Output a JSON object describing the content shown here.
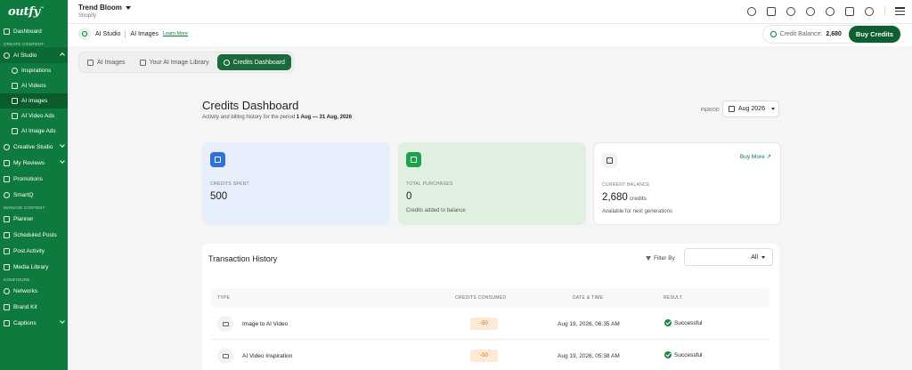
{
  "sidebar": {
    "logo": "outfy",
    "logo_mark": "™",
    "items": [
      {
        "label": "Dashboard"
      },
      {
        "section": "Create Content"
      },
      {
        "label": "AI Studio"
      },
      {
        "label": "Inspirations"
      },
      {
        "label": "AI Videos"
      },
      {
        "label": "AI Images"
      },
      {
        "label": "AI Video Ads"
      },
      {
        "label": "AI Image Ads"
      },
      {
        "label": "Creative Studio"
      },
      {
        "label": "My Reviews"
      },
      {
        "label": "Promotions"
      },
      {
        "label": "SmartQ"
      },
      {
        "section": "Manage Content"
      },
      {
        "label": "Planner"
      },
      {
        "label": "Scheduled Posts"
      },
      {
        "label": "Post Activity"
      },
      {
        "label": "Media Library"
      },
      {
        "section": "Configure"
      },
      {
        "label": "Networks"
      },
      {
        "label": "Brand Kit"
      },
      {
        "label": "Captions"
      }
    ]
  },
  "topbar": {
    "brand": "Trend Bloom",
    "platform": "Shopify"
  },
  "subbar": {
    "crumb_root": "AI Studio",
    "crumb_current": "AI Images",
    "learn_more": "Learn More",
    "credit_label": "Credit Balance:",
    "credit_value": "2,680",
    "buy_credits": "Buy Credits"
  },
  "tabs": [
    {
      "label": "AI Images"
    },
    {
      "label": "Your AI Image Library"
    },
    {
      "label": "Credits Dashboard"
    }
  ],
  "dashboard": {
    "title": "Credits Dashboard",
    "subtitle": "Activity and billing history for the period",
    "period_range": "1 Aug — 31 Aug, 2026",
    "period_label": "PERIOD",
    "period_value": "Aug 2026"
  },
  "cards": {
    "spent": {
      "label": "CREDITS SPENT",
      "value": "500"
    },
    "purchases": {
      "label": "TOTAL PURCHASES",
      "value": "0",
      "note": "Credits added to balance"
    },
    "balance": {
      "label": "CURRENT BALANCE",
      "value": "2,680",
      "unit": "credits",
      "note": "Available for next generations",
      "buy_more": "Buy More"
    }
  },
  "transactions": {
    "title": "Transaction History",
    "filter_label": "Filter By",
    "filter_value": "All",
    "columns": [
      "TYPE",
      "CREDITS CONSUMED",
      "DATE & TIME",
      "RESULT"
    ],
    "rows": [
      {
        "type": "Image to AI Video",
        "credits": "-50",
        "datetime": "Aug 19, 2026, 06:35 AM",
        "result": "Successful"
      },
      {
        "type": "AI Video Inspiration",
        "credits": "-50",
        "datetime": "Aug 19, 2026, 05:38 AM",
        "result": "Successful"
      }
    ]
  },
  "colors": {
    "brand_green": "#0f7a3d",
    "button_green": "#0f5e2f",
    "card_blue": "#e6effb",
    "card_green": "#dff0e1",
    "credit_orange": "#d46a16"
  }
}
